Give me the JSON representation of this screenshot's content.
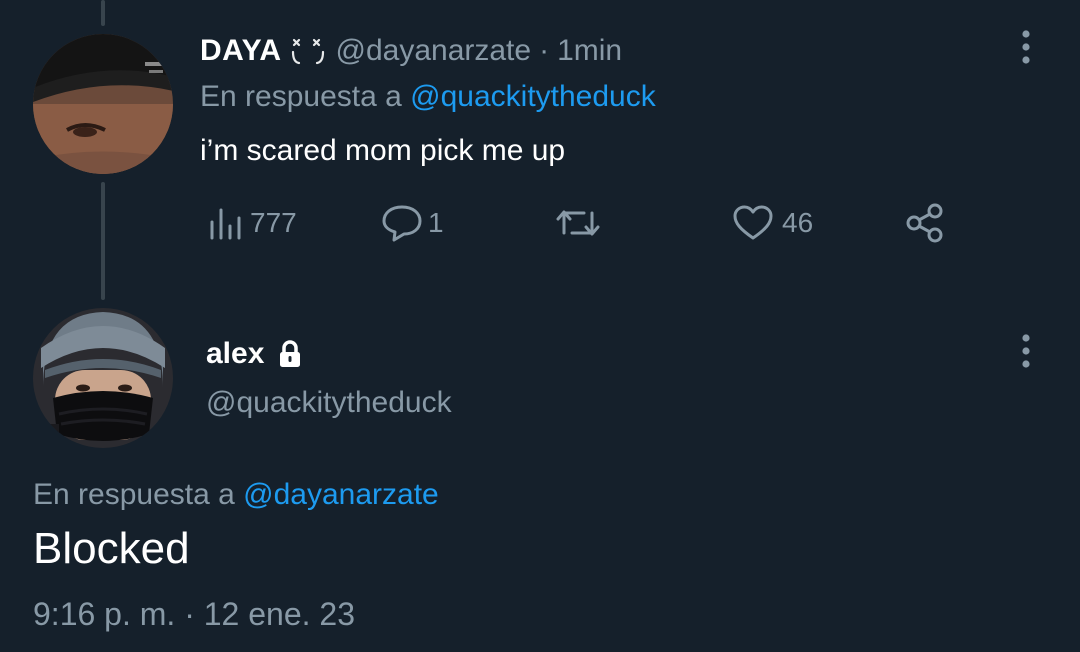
{
  "thread": {
    "parent_tweet": {
      "display_name": "DAYA",
      "name_emoji": "face-emoji",
      "handle": "@dayanarzate",
      "separator": "·",
      "time_ago": "1min",
      "reply_prefix": "En respuesta a",
      "reply_to": "@quackitytheduck",
      "text": "i’m scared mom pick me up",
      "actions": {
        "views": "777",
        "replies": "1",
        "retweets": "",
        "likes": "46"
      }
    },
    "main_tweet": {
      "display_name": "alex",
      "protected": true,
      "handle": "@quackitytheduck",
      "reply_prefix": "En respuesta a",
      "reply_to": "@dayanarzate",
      "text": "Blocked",
      "timestamp": "9:16 p. m. · 12 ene. 23"
    }
  },
  "colors": {
    "background": "#15202b",
    "primary_text": "#ffffff",
    "secondary_text": "#8899a6",
    "accent": "#1d9bf0",
    "thread_line": "#38444d"
  }
}
